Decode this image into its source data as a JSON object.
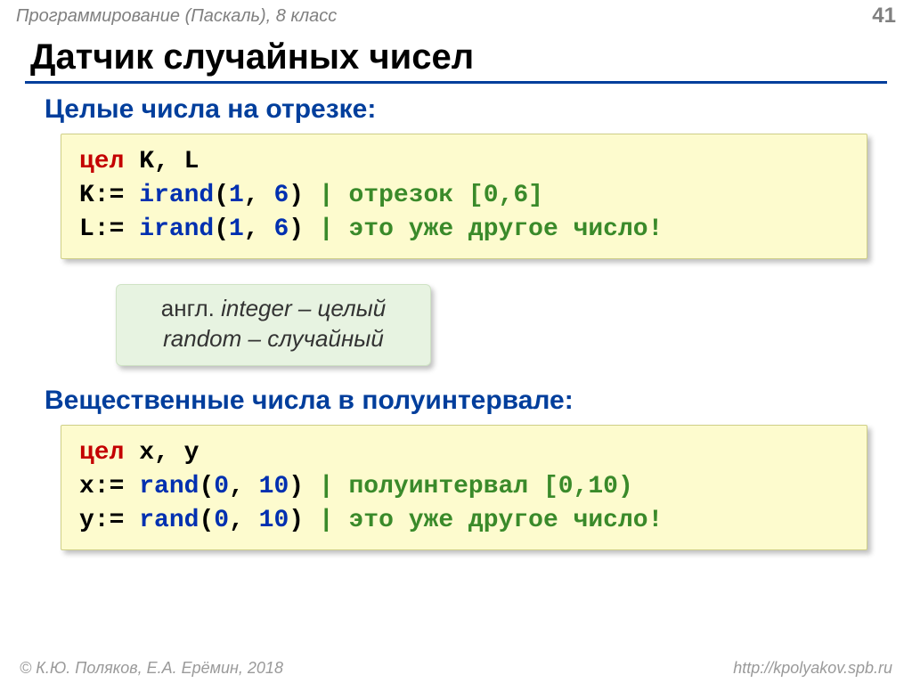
{
  "header": {
    "course": "Программирование (Паскаль), 8 класс",
    "page": "41"
  },
  "title": "Датчик случайных чисел",
  "section1": {
    "heading": "Целые числа на отрезке:",
    "code": {
      "decl_kw": "цел",
      "decl_vars": " K, L",
      "l2_lhs": "K:= ",
      "l2_fn": "irand",
      "l2_paren_open": "(",
      "l2_arg1": "1",
      "l2_comma": ", ",
      "l2_arg2": "6",
      "l2_paren_close": ")",
      "l2_cmt": " | отрезок [0,6]",
      "l3_lhs": "L:= ",
      "l3_fn": "irand",
      "l3_paren_open": "(",
      "l3_arg1": "1",
      "l3_comma": ", ",
      "l3_arg2": "6",
      "l3_paren_close": ")",
      "l3_cmt": " | это уже другое число!"
    }
  },
  "note": {
    "line1_prefix": "англ. ",
    "line1_word": "integer",
    "line1_suffix": " – целый",
    "line2_word": "random",
    "line2_suffix": " – случайный"
  },
  "section2": {
    "heading": "Вещественные числа в полуинтервале:",
    "code": {
      "decl_kw": "цел",
      "decl_vars": " x, y",
      "l2_lhs": "x:= ",
      "l2_fn": "rand",
      "l2_paren_open": "(",
      "l2_arg1": "0",
      "l2_comma": ", ",
      "l2_arg2": "10",
      "l2_paren_close": ")",
      "l2_cmt": " | полуинтервал [0,10)",
      "l3_lhs": "y:= ",
      "l3_fn": "rand",
      "l3_paren_open": "(",
      "l3_arg1": "0",
      "l3_comma": ", ",
      "l3_arg2": "10",
      "l3_paren_close": ")",
      "l3_cmt": " | это уже другое число!"
    }
  },
  "footer": {
    "left": "© К.Ю. Поляков, Е.А. Ерёмин, 2018",
    "right": "http://kpolyakov.spb.ru"
  }
}
